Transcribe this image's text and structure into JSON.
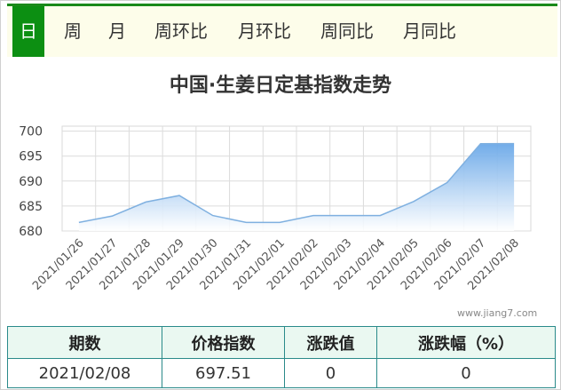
{
  "tabs": [
    {
      "label": "日",
      "active": true
    },
    {
      "label": "周"
    },
    {
      "label": "月"
    },
    {
      "label": "周环比"
    },
    {
      "label": "月环比"
    },
    {
      "label": "周同比"
    },
    {
      "label": "月同比"
    }
  ],
  "watermark": "www.jiang7.com",
  "colors": {
    "accent": "#0c8f12",
    "line": "#7fb0e0",
    "area_top": "#6aa8e8"
  },
  "chart_data": {
    "type": "area",
    "title": "中国·生姜日定基指数走势",
    "x": [
      "2021/01/26",
      "2021/01/27",
      "2021/01/28",
      "2021/01/29",
      "2021/01/30",
      "2021/01/31",
      "2021/02/01",
      "2021/02/02",
      "2021/02/03",
      "2021/02/04",
      "2021/02/05",
      "2021/02/06",
      "2021/02/07",
      "2021/02/08"
    ],
    "series": [
      {
        "values": [
          681.7,
          683.0,
          685.8,
          687.1,
          683.1,
          681.7,
          681.7,
          683.1,
          683.1,
          683.1,
          685.9,
          689.7,
          697.5,
          697.51
        ]
      }
    ],
    "yticks": [
      680,
      685,
      690,
      695,
      700
    ],
    "ylim": [
      680,
      701
    ],
    "grid": true,
    "legend": "none"
  },
  "summary_table": {
    "headers": [
      "期数",
      "价格指数",
      "涨跌值",
      "涨跌幅（%）"
    ],
    "row": [
      "2021/02/08",
      "697.51",
      "0",
      "0"
    ]
  }
}
